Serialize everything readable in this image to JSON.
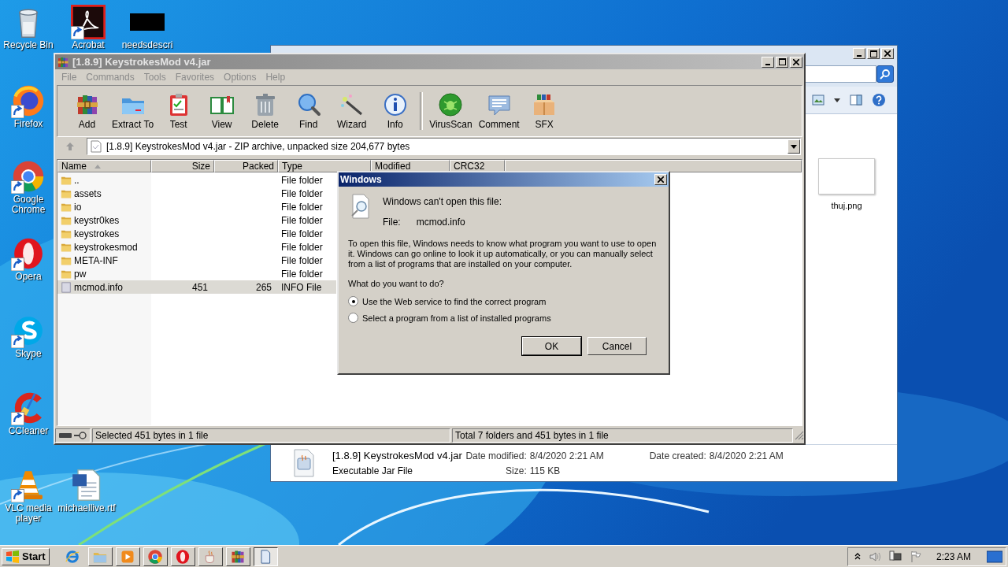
{
  "desktop_icons": [
    {
      "kind": "bin",
      "label": "Recycle Bin",
      "shortcut": false
    },
    {
      "kind": "acrobat",
      "label": "Acrobat",
      "shortcut": true
    },
    {
      "kind": "blackbox",
      "label": "needsdescri",
      "shortcut": false
    },
    {
      "kind": "firefox",
      "label": "Firefox",
      "shortcut": true
    },
    {
      "kind": "chrome",
      "label": "Google Chrome",
      "shortcut": true
    },
    {
      "kind": "opera",
      "label": "Opera",
      "shortcut": true
    },
    {
      "kind": "skype",
      "label": "Skype",
      "shortcut": true
    },
    {
      "kind": "ccleaner",
      "label": "CCleaner",
      "shortcut": true
    },
    {
      "kind": "vlc",
      "label": "VLC media player",
      "shortcut": true
    },
    {
      "kind": "word",
      "label": "michaellive.rtf",
      "shortcut": false
    }
  ],
  "explorer_window": {
    "files": [
      {
        "name": "thuj.png"
      }
    ],
    "details": {
      "name": "[1.8.9] KeystrokesMod v4.jar",
      "type": "Executable Jar File",
      "fields": [
        {
          "label": "Date modified:",
          "value": "8/4/2020 2:21 AM"
        },
        {
          "label": "Date created:",
          "value": "8/4/2020 2:21 AM"
        },
        {
          "label": "Size:",
          "value": "115 KB"
        }
      ]
    }
  },
  "archive_window": {
    "title": "[1.8.9] KeystrokesMod v4.jar",
    "menu": [
      {
        "label": "File",
        "disabled": true
      },
      {
        "label": "Commands",
        "disabled": true
      },
      {
        "label": "Tools",
        "disabled": true
      },
      {
        "label": "Favorites",
        "disabled": true
      },
      {
        "label": "Options",
        "disabled": true
      },
      {
        "label": "Help",
        "disabled": true
      }
    ],
    "toolbar_groups": [
      {
        "buttons": [
          {
            "kind": "add",
            "label": "Add"
          },
          {
            "kind": "extract",
            "label": "Extract To"
          },
          {
            "kind": "test",
            "label": "Test"
          },
          {
            "kind": "view",
            "label": "View"
          },
          {
            "kind": "delete",
            "label": "Delete"
          },
          {
            "kind": "find",
            "label": "Find"
          },
          {
            "kind": "wizard",
            "label": "Wizard"
          },
          {
            "kind": "info",
            "label": "Info"
          }
        ]
      },
      {
        "buttons": [
          {
            "kind": "virusscan",
            "label": "VirusScan"
          },
          {
            "kind": "comment",
            "label": "Comment"
          },
          {
            "kind": "sfx",
            "label": "SFX"
          }
        ]
      }
    ],
    "address": "[1.8.9] KeystrokesMod v4.jar - ZIP archive, unpacked size 204,677 bytes",
    "columns": [
      {
        "label": "Name",
        "sorted": true
      },
      {
        "label": "Size",
        "sorted": false
      },
      {
        "label": "Packed",
        "sorted": false
      },
      {
        "label": "Type",
        "sorted": false
      },
      {
        "label": "Modified",
        "sorted": false
      },
      {
        "label": "CRC32",
        "sorted": false
      }
    ],
    "rows": [
      {
        "kind": "folder",
        "name": "..",
        "type": "File folder",
        "selected": false
      },
      {
        "kind": "folder",
        "name": "assets",
        "type": "File folder",
        "selected": false
      },
      {
        "kind": "folder",
        "name": "io",
        "type": "File folder",
        "selected": false
      },
      {
        "kind": "folder",
        "name": "keystr0kes",
        "type": "File folder",
        "selected": false
      },
      {
        "kind": "folder",
        "name": "keystrokes",
        "type": "File folder",
        "selected": false
      },
      {
        "kind": "folder",
        "name": "keystrokesmod",
        "type": "File folder",
        "selected": false
      },
      {
        "kind": "folder",
        "name": "META-INF",
        "type": "File folder",
        "selected": false
      },
      {
        "kind": "folder",
        "name": "pw",
        "type": "File folder",
        "selected": false
      },
      {
        "kind": "file",
        "name": "mcmod.info",
        "size": "451",
        "packed": "265",
        "type": "INFO File",
        "selected": true
      }
    ],
    "status_bar": {
      "left": "Selected 451 bytes in 1 file",
      "right": "Total 7 folders and 451 bytes in 1 file"
    }
  },
  "dialog": {
    "title": "Windows",
    "heading": "Windows can't open this file:",
    "file_label": "File:",
    "file_name": "mcmod.info",
    "message": "To open this file, Windows needs to know what program you want to use to open it. Windows can go online to look it up automatically, or you can manually select from a list of programs that are installed on your computer.",
    "question": "What do you want to do?",
    "options": [
      {
        "label": "Use the Web service to find the correct program",
        "selected": true
      },
      {
        "label": "Select a program from a list of installed programs",
        "selected": false
      }
    ],
    "buttons": [
      {
        "label": "OK",
        "default": true
      },
      {
        "label": "Cancel",
        "default": false
      }
    ]
  },
  "taskbar": {
    "start": "Start",
    "items": [
      {
        "kind": "ie",
        "selected": false
      },
      {
        "kind": "folder",
        "selected": false
      },
      {
        "kind": "media",
        "selected": false
      },
      {
        "kind": "chrome",
        "selected": false
      },
      {
        "kind": "opera",
        "selected": false
      },
      {
        "kind": "java",
        "selected": false
      },
      {
        "kind": "winrar",
        "selected": false
      },
      {
        "kind": "doc",
        "selected": true
      }
    ],
    "clock": "2:23 AM"
  }
}
